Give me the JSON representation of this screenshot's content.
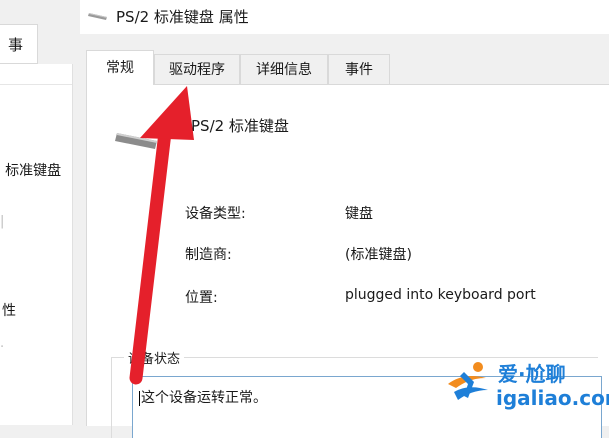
{
  "background_window": {
    "tab_label": "事件",
    "device_entry": ": 标准键盘",
    "section_label": "性"
  },
  "dialog": {
    "title": "PS/2 标准键盘 属性",
    "tabs": [
      {
        "label": "常规",
        "active": true
      },
      {
        "label": "驱动程序",
        "active": false
      },
      {
        "label": "详细信息",
        "active": false
      },
      {
        "label": "事件",
        "active": false
      }
    ],
    "device_name": "PS/2 标准键盘",
    "properties": [
      {
        "label": "设备类型:",
        "value": "键盘"
      },
      {
        "label": "制造商:",
        "value": "(标准键盘)"
      },
      {
        "label": "位置:",
        "value": "plugged into keyboard port"
      }
    ],
    "status_group_label": "设备状态",
    "status_text": "这个设备运转正常。"
  },
  "annotation": {
    "arrow_color": "#e5202b",
    "arrow_target": "驱动程序"
  },
  "watermark": {
    "cn": "爱·尬聊",
    "en": "igaliao.com",
    "color": "#1e7fd8",
    "accent": "#f28c1e"
  }
}
